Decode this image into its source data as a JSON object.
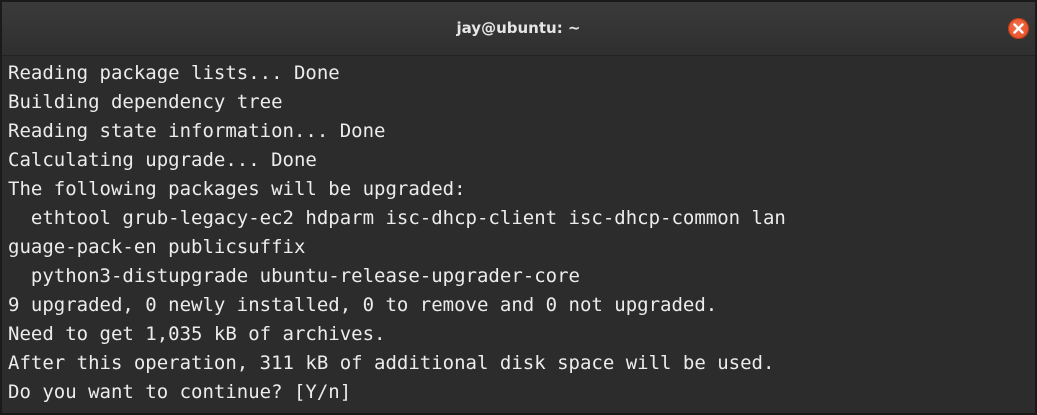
{
  "window": {
    "title": "jay@ubuntu: ~"
  },
  "terminal": {
    "lines": [
      "Reading package lists... Done",
      "Building dependency tree",
      "Reading state information... Done",
      "Calculating upgrade... Done",
      "The following packages will be upgraded:",
      "  ethtool grub-legacy-ec2 hdparm isc-dhcp-client isc-dhcp-common lan",
      "guage-pack-en publicsuffix",
      "  python3-distupgrade ubuntu-release-upgrader-core",
      "9 upgraded, 0 newly installed, 0 to remove and 0 not upgraded.",
      "Need to get 1,035 kB of archives.",
      "After this operation, 311 kB of additional disk space will be used.",
      "Do you want to continue? [Y/n]"
    ]
  },
  "colors": {
    "background": "#2c2c2c",
    "text": "#ececec",
    "close_button": "#e95420"
  },
  "icons": {
    "close": "close-icon"
  }
}
